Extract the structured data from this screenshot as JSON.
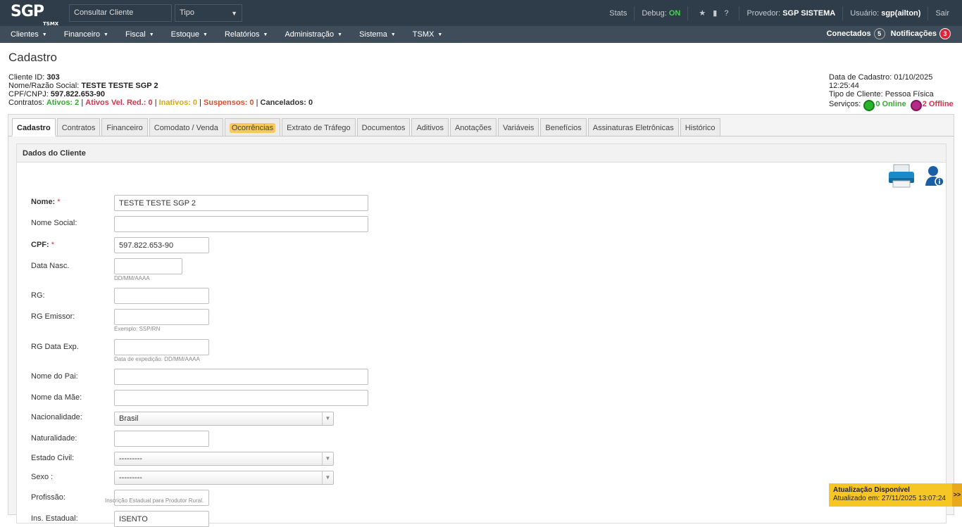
{
  "header": {
    "logo": "SGP",
    "logo_sub": "TSMX",
    "search_placeholder": "Consultar Cliente",
    "tipo_select": "Tipo",
    "stats": "Stats",
    "debug_label": "Debug:",
    "debug_value": "ON",
    "provedor_label": "Provedor:",
    "provedor_value": "SGP SISTEMA",
    "usuario_label": "Usuário:",
    "usuario_value": "sgp(ailton)",
    "sair": "Sair"
  },
  "menu": {
    "items": [
      "Clientes",
      "Financeiro",
      "Fiscal",
      "Estoque",
      "Relatórios",
      "Administração",
      "Sistema",
      "TSMX"
    ],
    "conectados_label": "Conectados",
    "conectados_count": "5",
    "notificacoes_label": "Notificações",
    "notificacoes_count": "3"
  },
  "page": {
    "title": "Cadastro",
    "cliente_id_label": "Cliente ID:",
    "cliente_id": "303",
    "nome_label": "Nome/Razão Social:",
    "nome": "TESTE TESTE SGP 2",
    "cpf_label": "CPF/CNPJ:",
    "cpf": "597.822.653-90",
    "contratos_label": "Contratos:",
    "ativos": "Ativos: 2",
    "ativos_vel": "Ativos Vel. Red.: 0",
    "inativos": "Inativos: 0",
    "suspensos": "Suspensos: 0",
    "cancelados": "Cancelados: 0",
    "sep": "|",
    "data_cadastro": "Data de Cadastro: 01/10/2025 12:25:44",
    "tipo_cliente": "Tipo de Cliente: Pessoa Física",
    "servicos_label": "Serviços:",
    "online": "0 Online",
    "offline": "2 Offline"
  },
  "tabs": [
    "Cadastro",
    "Contratos",
    "Financeiro",
    "Comodato / Venda",
    "Ocorrências",
    "Extrato de Tráfego",
    "Documentos",
    "Aditivos",
    "Anotações",
    "Variáveis",
    "Benefícios",
    "Assinaturas Eletrônicas",
    "Histórico"
  ],
  "form": {
    "section_title": "Dados do Cliente",
    "nome_label": "Nome:",
    "nome_value": "TESTE TESTE SGP 2",
    "nome_social_label": "Nome Social:",
    "cpf_label": "CPF:",
    "cpf_value": "597.822.653-90",
    "data_nasc_label": "Data Nasc.",
    "data_nasc_hint": "DD/MM/AAAA",
    "rg_label": "RG:",
    "rg_emissor_label": "RG Emissor:",
    "rg_emissor_hint": "Exemplo: SSP/RN",
    "rg_data_label": "RG Data Exp.",
    "rg_data_hint": "Data de expedição. DD/MM/AAAA",
    "pai_label": "Nome do Pai:",
    "mae_label": "Nome da Mãe:",
    "nacionalidade_label": "Nacionalidade:",
    "nacionalidade_value": "Brasil",
    "naturalidade_label": "Naturalidade:",
    "estado_civil_label": "Estado Civil:",
    "estado_civil_value": "---------",
    "sexo_label": "Sexo :",
    "sexo_value": "---------",
    "profissao_label": "Profissão:",
    "ie_label": "Ins. Estadual:",
    "ie_value": "ISENTO",
    "ie_hint": "Inscrição Estadual para Produtor Rural.",
    "required_mark": "*"
  },
  "update": {
    "title": "Atualização Disponível",
    "detail": "Atualizado em: 27/11/2025 13:07:24",
    "go": ">>"
  }
}
